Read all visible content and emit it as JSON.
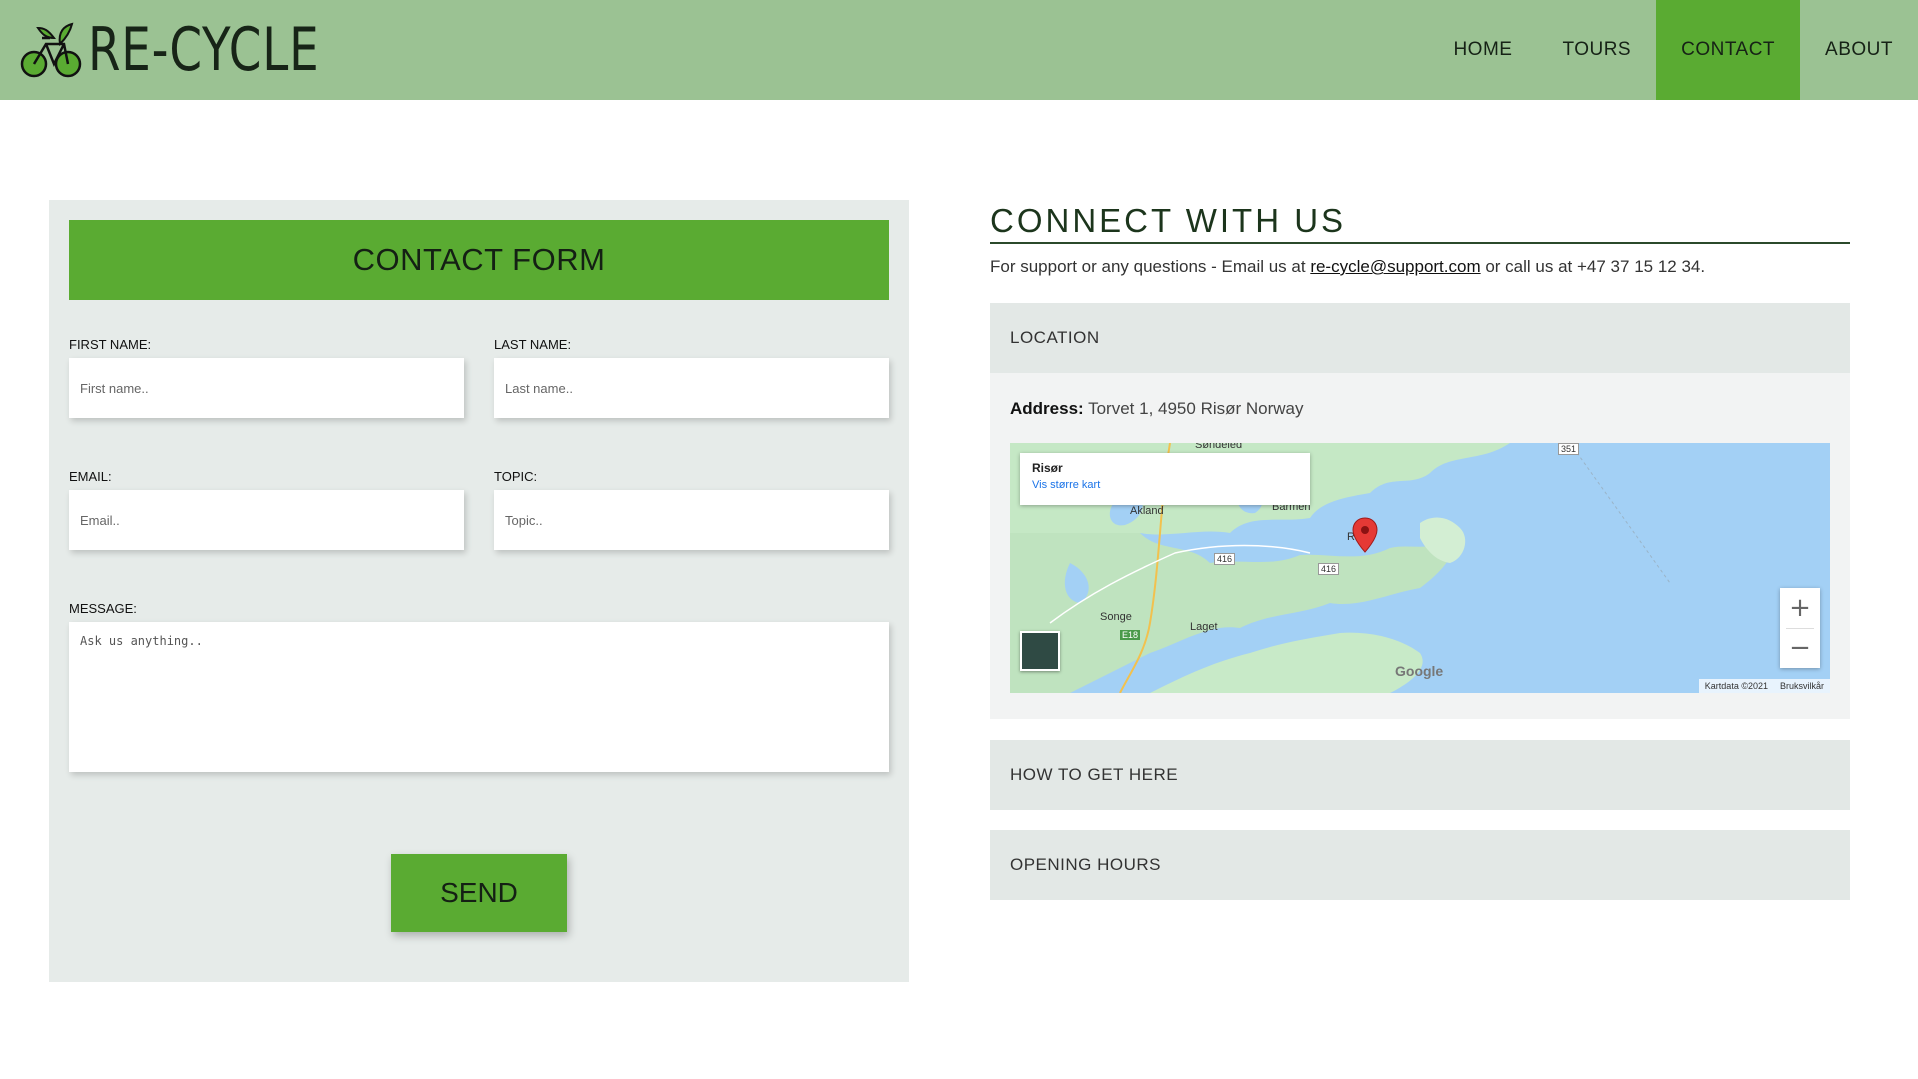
{
  "header": {
    "logo_text": "RE-CYCLE",
    "nav": [
      {
        "label": "HOME",
        "active": false
      },
      {
        "label": "TOURS",
        "active": false
      },
      {
        "label": "CONTACT",
        "active": true
      },
      {
        "label": "ABOUT",
        "active": false
      }
    ]
  },
  "form": {
    "title": "CONTACT FORM",
    "first_name_label": "FIRST NAME:",
    "first_name_placeholder": "First name..",
    "last_name_label": "LAST NAME:",
    "last_name_placeholder": "Last name..",
    "email_label": "EMAIL:",
    "email_placeholder": "Email..",
    "topic_label": "TOPIC:",
    "topic_placeholder": "Topic..",
    "message_label": "MESSAGE:",
    "message_placeholder": "Ask us anything..",
    "send_label": "SEND"
  },
  "connect": {
    "title": "CONNECT WITH US",
    "text_before": "For support or any questions - Email us at ",
    "email": "re-cycle@support.com",
    "text_after": " or call us at +47 37 15 12 34."
  },
  "accordion": {
    "location_label": "LOCATION",
    "address_label": "Address:",
    "address_value": " Torvet 1, 4950 Risør Norway",
    "how_label": "HOW TO GET HERE",
    "hours_label": "OPENING HOURS"
  },
  "map": {
    "place_title": "Risør",
    "place_link": "Vis større kart",
    "labels": [
      "Akland",
      "Barmen",
      "Risør",
      "Songe",
      "Laget",
      "Søndeled"
    ],
    "road_labels": [
      "416",
      "416",
      "E18",
      "351"
    ],
    "google": "Google",
    "footer_data": "Kartdata ©2021",
    "footer_terms": "Bruksvilkår",
    "zoom_in": "+",
    "zoom_out": "−"
  },
  "colors": {
    "header_bg": "#9bc293",
    "accent": "#5aab32",
    "panel_bg": "#e6ebe9"
  }
}
